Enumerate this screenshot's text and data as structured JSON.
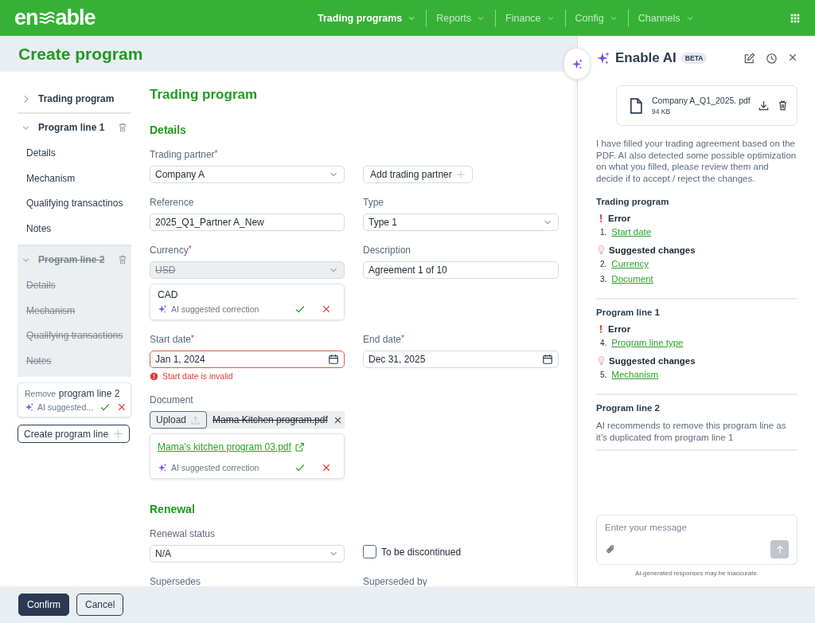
{
  "header": {
    "logo": {
      "start": "en",
      "end": "able"
    },
    "nav": [
      {
        "label": "Trading programs",
        "selected": true
      },
      {
        "label": "Reports",
        "selected": false
      },
      {
        "label": "Finance",
        "selected": false
      },
      {
        "label": "Config",
        "selected": false
      },
      {
        "label": "Channels",
        "selected": false
      }
    ]
  },
  "page_title": "Create program",
  "sidebar": {
    "items": [
      {
        "label": "Trading program",
        "expanded": false,
        "removed": false,
        "deletable": false
      },
      {
        "label": "Program line 1",
        "expanded": true,
        "removed": false,
        "deletable": true,
        "children": [
          {
            "label": "Details"
          },
          {
            "label": "Mechanism"
          },
          {
            "label": "Qualifying transactinos"
          },
          {
            "label": "Notes"
          }
        ]
      },
      {
        "label": "Program line 2",
        "expanded": true,
        "removed": true,
        "deletable": true,
        "children": [
          {
            "label": "Details"
          },
          {
            "label": "Mechanism"
          },
          {
            "label": "Qualifying transactions"
          },
          {
            "label": "Notes"
          }
        ]
      }
    ],
    "suggestion": {
      "action": "Remove",
      "target": "program line 2",
      "note": "AI suggested..."
    },
    "create_button": "Create program line"
  },
  "form": {
    "title": "Trading program",
    "sections": [
      {
        "title": "Details",
        "rows": [
          {
            "left": {
              "kind": "select",
              "label": "Trading partner",
              "required_mark": "*",
              "value": "Company A"
            },
            "right": {
              "kind": "button",
              "text": "Add trading partner"
            }
          },
          {
            "left": {
              "kind": "input",
              "label": "Reference",
              "value": "2025_Q1_Partner A_New"
            },
            "right": {
              "kind": "select",
              "label": "Type",
              "value": "Type 1"
            }
          },
          {
            "left": {
              "kind": "select",
              "label": "Currency",
              "required_mark": "*",
              "value": "USD",
              "rejected": true,
              "suggestion": {
                "kind": "text",
                "value": "CAD",
                "note": "AI suggested correction"
              }
            },
            "right": {
              "kind": "input",
              "label": "Description",
              "value": "Agreement 1 of 10"
            }
          },
          {
            "left": {
              "kind": "date",
              "label": "Start date",
              "required_mark": "*",
              "value": "Jan 1, 2024",
              "error": "Start date is invalid"
            },
            "right": {
              "kind": "date",
              "label": "End date",
              "required_mark": "*",
              "value": "Dec 31, 2025"
            }
          },
          {
            "left": {
              "kind": "upload",
              "label": "Document",
              "button": "Upload",
              "file": "Mama Kitchen program.pdf",
              "rejected": true,
              "suggestion": {
                "kind": "link",
                "value": "Mama’s kitchen program 03.pdf",
                "note": "AI suggested correction"
              }
            }
          }
        ]
      },
      {
        "title": "Renewal",
        "rows": [
          {
            "left": {
              "kind": "select",
              "label": "Renewal status",
              "value": "N/A"
            },
            "right": {
              "kind": "checkbox",
              "text": "To be discontinued",
              "checked": false
            }
          },
          {
            "left": {
              "kind": "label",
              "label": "Supersedes"
            },
            "right": {
              "kind": "label",
              "label": "Superseded by"
            }
          }
        ]
      }
    ]
  },
  "ai_panel": {
    "title": "Enable AI",
    "badge": "BETA",
    "file": {
      "name": "Company A_Q1_2025. pdf",
      "size": "94 KB"
    },
    "intro": "I have filled your trading agreement based on the PDF. AI also detected some possible optimization on what you filled, please review them and decide if to accept / reject the changes.",
    "sections": [
      {
        "title": "Trading program",
        "groups": [
          {
            "kind": "error",
            "label": "Error",
            "items": [
              {
                "number": "1.",
                "label": "Start date"
              }
            ]
          },
          {
            "kind": "suggestion",
            "label": "Suggested changes",
            "items": [
              {
                "number": "2.",
                "label": "Currency"
              },
              {
                "number": "3.",
                "label": "Document"
              }
            ]
          }
        ]
      },
      {
        "title": "Program line 1",
        "groups": [
          {
            "kind": "error",
            "label": "Error",
            "items": [
              {
                "number": "4.",
                "label": "Program line type"
              }
            ]
          },
          {
            "kind": "suggestion",
            "label": "Suggested changes",
            "items": [
              {
                "number": "5.",
                "label": "Mechanism"
              }
            ]
          }
        ]
      },
      {
        "title": "Program line 2",
        "text": "AI recommends to remove this program line as it’s duplicated from program line 1"
      }
    ],
    "message": {
      "placeholder": "Enter your message",
      "send_disabled": true
    },
    "disclaimer": "AI-generated responses may be inaccurate."
  },
  "footer": {
    "buttons": [
      {
        "label": "Confirm",
        "kind": "primary"
      },
      {
        "label": "Cancel",
        "kind": "secondary"
      }
    ]
  }
}
